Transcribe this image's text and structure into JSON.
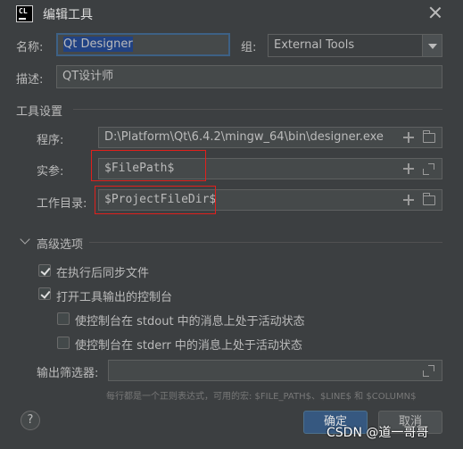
{
  "window": {
    "title": "编辑工具",
    "app_icon_text": "CL"
  },
  "form": {
    "name_label": "名称:",
    "name_value": "Qt Designer",
    "group_label": "组:",
    "group_value": "External Tools",
    "desc_label": "描述:",
    "desc_value": "QT设计师"
  },
  "tool_settings": {
    "section_title": "工具设置",
    "program_label": "程序:",
    "program_value": "D:\\Platform\\Qt\\6.4.2\\mingw_64\\bin\\designer.exe",
    "args_label": "实参:",
    "args_value": "$FilePath$",
    "workdir_label": "工作目录:",
    "workdir_value": "$ProjectFileDir$"
  },
  "advanced": {
    "section_title": "高级选项",
    "sync_label": "在执行后同步文件",
    "sync_checked": true,
    "console_label": "打开工具输出的控制台",
    "console_checked": true,
    "stdout_label": "使控制台在 stdout 中的消息上处于活动状态",
    "stdout_checked": false,
    "stderr_label": "使控制台在 stderr 中的消息上处于活动状态",
    "stderr_checked": false,
    "filter_label": "输出筛选器:",
    "filter_value": "",
    "hint": "每行都是一个正则表达式，可用的宏: $FILE_PATH$、$LINE$ 和 $COLUMN$"
  },
  "footer": {
    "help": "?",
    "ok": "确定",
    "cancel": "取消"
  },
  "watermark": "CSDN @道一哥哥",
  "colors": {
    "background": "#3c3f41",
    "field": "#45494a",
    "highlight_box": "#e0201c",
    "primary_button": "#365880",
    "selection": "#214283"
  }
}
